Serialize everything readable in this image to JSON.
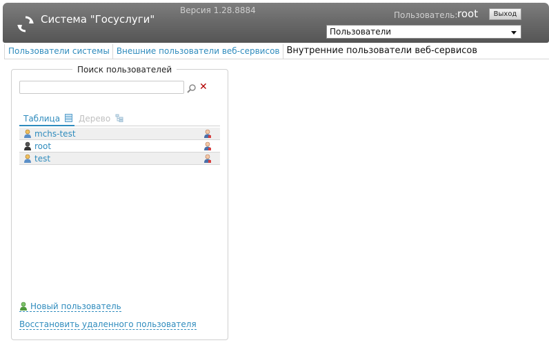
{
  "header": {
    "app_title": "Система \"Госуслуги\"",
    "version": "Версия 1.28.8884",
    "user_label": "Пользователь:",
    "user_name": "root",
    "logout_label": "Выход",
    "section_select_value": "Пользователи"
  },
  "tabs": [
    {
      "label": "Пользователи системы",
      "active": false
    },
    {
      "label": "Внешние пользователи веб-сервисов",
      "active": false
    },
    {
      "label": "Внутренние пользователи веб-сервисов",
      "active": true
    }
  ],
  "search_panel": {
    "legend": "Поиск пользователей",
    "search_value": "",
    "view_tabs": {
      "table_label": "Таблица",
      "tree_label": "Дерево",
      "selected": "table"
    },
    "users": [
      {
        "name": "mchs-test",
        "icon": "user-icon-yellow"
      },
      {
        "name": "root",
        "icon": "user-icon-dark"
      },
      {
        "name": "test",
        "icon": "user-icon-yellow"
      }
    ],
    "new_user_label": "Новый пользователь",
    "restore_user_label": "Восстановить удаленного пользователя"
  },
  "colors": {
    "link": "#2e8bbd",
    "header_top": "#7e7e7e",
    "header_bottom": "#555555",
    "clear": "#b30000"
  }
}
